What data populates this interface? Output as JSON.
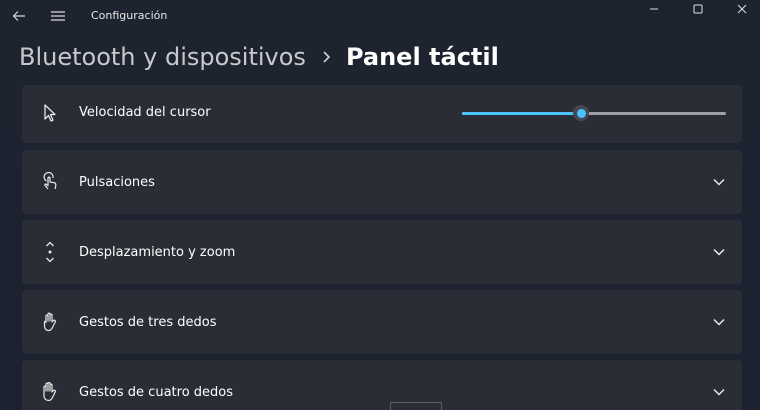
{
  "window": {
    "app_title": "Configuración"
  },
  "breadcrumb": {
    "parent": "Bluetooth y dispositivos",
    "current": "Panel táctil"
  },
  "settings": [
    {
      "label": "Velocidad del cursor",
      "icon": "cursor-icon",
      "control": "slider"
    },
    {
      "label": "Pulsaciones",
      "icon": "tap-icon",
      "control": "chevron"
    },
    {
      "label": "Desplazamiento y zoom",
      "icon": "scroll-zoom-icon",
      "control": "chevron"
    },
    {
      "label": "Gestos de tres dedos",
      "icon": "three-finger-icon",
      "control": "chevron"
    },
    {
      "label": "Gestos de cuatro dedos",
      "icon": "four-finger-icon",
      "control": "chevron"
    }
  ],
  "cursor_speed": {
    "value": 0.45
  },
  "colors": {
    "accent": "#4cc2ff",
    "card_bg": "#2a2d36",
    "window_bg": "#1e2330"
  }
}
